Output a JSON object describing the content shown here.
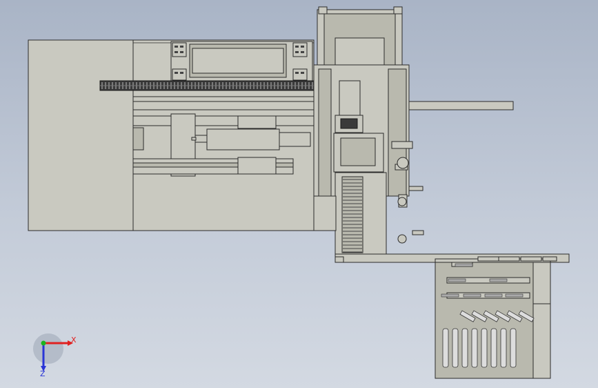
{
  "triad": {
    "x_label": "X",
    "z_label": "Z",
    "x_color": "#e02020",
    "y_color": "#1db41d",
    "z_color": "#2a35d6"
  }
}
